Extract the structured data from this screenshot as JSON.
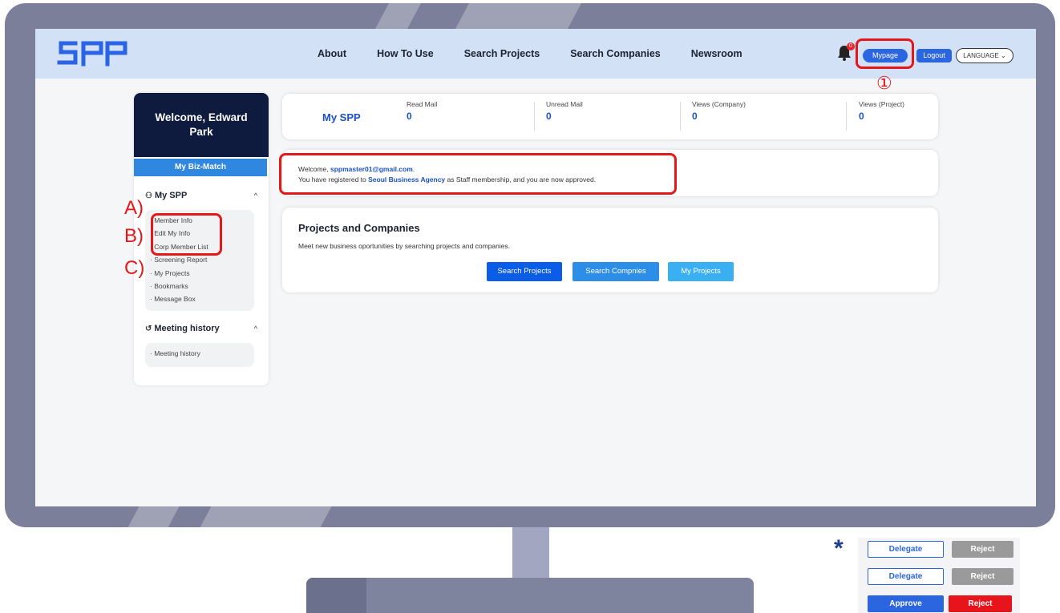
{
  "nav": {
    "logo": "SPP",
    "links": [
      "About",
      "How To Use",
      "Search Projects",
      "Search Companies",
      "Newsroom"
    ],
    "notification_count": "0",
    "mypage_label": "Mypage",
    "logout_label": "Logout",
    "language_label": "LANGUAGE"
  },
  "sidebar": {
    "welcome": "Welcome, Edward Park",
    "biz_match_label": "My Biz-Match",
    "my_spp": {
      "title": "My SPP",
      "items": [
        "· Member Info",
        "· Edit My Info",
        "· Corp Member List",
        "· Screening Report",
        "· My Projects",
        "· Bookmarks",
        "· Message Box"
      ]
    },
    "meeting": {
      "title": "Meeting history",
      "items": [
        "· Meeting history"
      ]
    }
  },
  "stats": {
    "title": "My SPP",
    "items": [
      {
        "label": "Read Mail",
        "value": "0"
      },
      {
        "label": "Unread Mail",
        "value": "0"
      },
      {
        "label": "Views (Company)",
        "value": "0"
      },
      {
        "label": "Views (Project)",
        "value": "0"
      }
    ]
  },
  "welcome_card": {
    "line1_prefix": "Welcome, ",
    "email": "sppmaster01@gmail.com",
    "line1_suffix": ".",
    "line2_prefix": "You have registered to ",
    "agency": "Seoul Business Agency",
    "line2_suffix": " as Staff membership, and you are now approved."
  },
  "projects": {
    "title": "Projects and Companies",
    "description": "Meet new business oportunities by searching projects and companies.",
    "buttons": [
      "Search Projects",
      "Search Compnies",
      "My Projects"
    ]
  },
  "annotations": {
    "circle_1": "①",
    "a": "A)",
    "b": "B)",
    "c": "C)",
    "star": "*"
  },
  "legend": {
    "delegate_label": "Delegate",
    "reject_label": "Reject",
    "approve_label": "Approve"
  },
  "colors": {
    "brand_blue": "#2b65e0",
    "navy": "#0e1a3e",
    "annotation_red": "#e41818"
  }
}
